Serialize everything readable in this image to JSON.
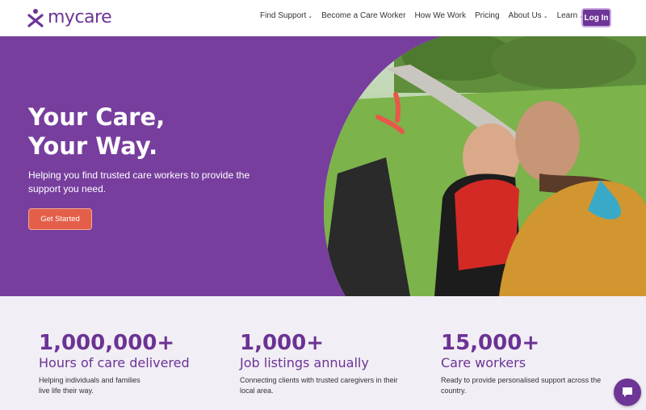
{
  "brand": {
    "name": "mycare",
    "color": "#6d3596"
  },
  "nav": {
    "items": [
      {
        "label": "Find Support",
        "has_dropdown": true
      },
      {
        "label": "Become a Care Worker",
        "has_dropdown": false
      },
      {
        "label": "How We Work",
        "has_dropdown": false
      },
      {
        "label": "Pricing",
        "has_dropdown": false
      },
      {
        "label": "About Us",
        "has_dropdown": true
      },
      {
        "label": "Learn",
        "has_dropdown": true
      }
    ],
    "login_label": "Log In"
  },
  "hero": {
    "title_line1": "Your Care,",
    "title_line2": "Your Way.",
    "subtitle": "Helping you find trusted care workers to provide the support you need.",
    "cta_label": "Get Started",
    "background": "#773e9e"
  },
  "stats": [
    {
      "value": "1,000,000+",
      "label": "Hours of care delivered",
      "desc_line1": "Helping individuals and families",
      "desc_line2": "live life their way."
    },
    {
      "value": "1,000+",
      "label": "Job listings annually",
      "desc_line1": "Connecting clients with trusted caregivers in their",
      "desc_line2": "local area."
    },
    {
      "value": "15,000+",
      "label": "Care workers",
      "desc_line1": "Ready to provide personalised support across the",
      "desc_line2": "country."
    }
  ],
  "icons": {
    "chevron": "chevron-down-icon",
    "chat": "chat-icon",
    "logo": "mycare-logo-icon"
  }
}
